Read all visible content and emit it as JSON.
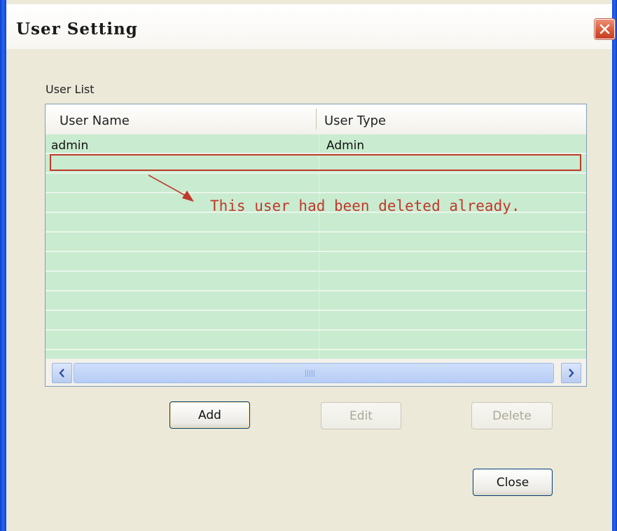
{
  "window": {
    "title": "User Setting",
    "close_glyph": "close-icon"
  },
  "user_list": {
    "label": "User List",
    "columns": [
      "User Name",
      "User Type"
    ],
    "rows": [
      {
        "user_name": "admin",
        "user_type": "Admin"
      }
    ],
    "annotation": "This user had been deleted already."
  },
  "scrollbar": {
    "left_icon": "chevron-left-icon",
    "right_icon": "chevron-right-icon"
  },
  "buttons": {
    "add": "Add",
    "edit": "Edit",
    "delete": "Delete",
    "close": "Close"
  },
  "colors": {
    "titlebar_border": "#2b65ea",
    "list_background": "#c9ebcf",
    "annotation": "#c0392b",
    "close_button": "#dd5a3a"
  }
}
